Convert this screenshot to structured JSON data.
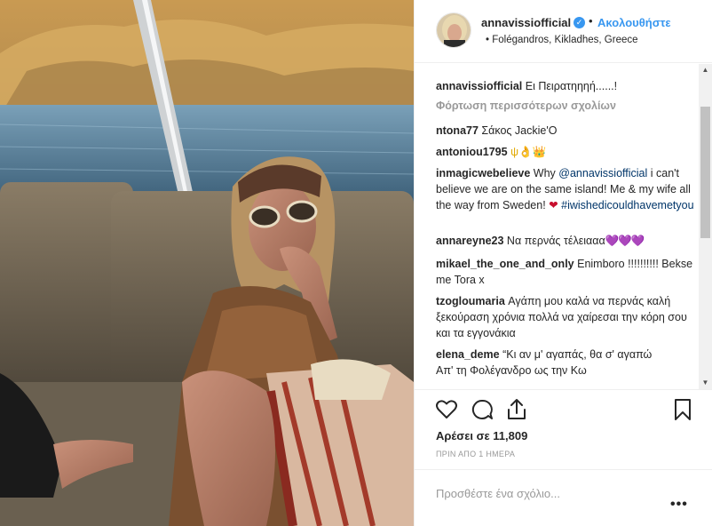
{
  "header": {
    "username": "annavissiofficial",
    "verified_icon": "verified-badge-icon",
    "separator": "•",
    "follow_label": "Ακολουθήστε",
    "location": "Folégandros, Kikladhes, Greece",
    "location_prefix": "•"
  },
  "comments": [
    {
      "user": "annavissiofficial",
      "text": "Ει Πειρατηηηή......!"
    },
    {
      "user": "ntona77",
      "text": "Σάκος Jackie'O"
    },
    {
      "user": "antoniou1795",
      "text": "ψ👌👑"
    },
    {
      "user": "inmagicwebelieve",
      "text_pre": "Why ",
      "mention": "@annavissiofficial",
      "text_post": " i can't believe we are on the same island! Me & my wife all the way from Sweden! ",
      "heart": "❤",
      "hashtag": "#iwishedicouldhavemetyou"
    },
    {
      "user": "annareyne23",
      "text": "Να περνάς τέλειααα",
      "hearts": "💜💜💜"
    },
    {
      "user": "mikael_the_one_and_only",
      "text": "Enimboro !!!!!!!!!! Bekse me Tora x"
    },
    {
      "user": "tzogloumaria",
      "text": "Αγάπη μου καλά να περνάς καλή ξεκούραση χρόνια πολλά να χαίρεσαι την κόρη σου και τα εγγονάκια"
    },
    {
      "user": "elena_deme",
      "text": "“Κι αν μ' αγαπάς, θα σ' αγαπώ",
      "text2": "Απ' τη Φολέγανδρο ως την Κω"
    }
  ],
  "load_more_label": "Φόρτωση περισσότερων σχολίων",
  "actions": {
    "like_icon": "heart-icon",
    "comment_icon": "comment-icon",
    "share_icon": "share-icon",
    "save_icon": "bookmark-icon"
  },
  "likes_text": "Αρέσει σε 11,809",
  "time_text": "ΠΡΙΝ ΑΠΟ 1 ΗΜΕΡΑ",
  "add_comment": {
    "placeholder": "Προσθέστε ένα σχόλιο...",
    "value": ""
  },
  "options_label": "•••",
  "scroll_up_glyph": "▲",
  "scroll_down_glyph": "▼"
}
